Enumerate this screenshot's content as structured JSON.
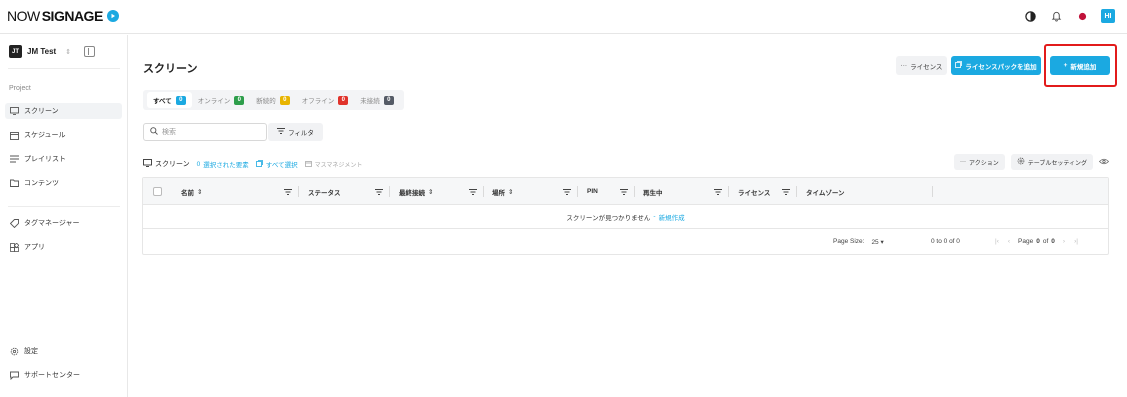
{
  "brand": {
    "logo_prefix": "NOW",
    "logo_suffix": "SIGNAGE",
    "accent": "#1ba9e1"
  },
  "topbar": {
    "avatar_initials": "HI",
    "icons": [
      "contrast-icon",
      "bell-icon",
      "record-icon",
      "avatar"
    ]
  },
  "sidebar": {
    "workspace": {
      "initials": "JT",
      "name": "JM Test"
    },
    "section_label": "Project",
    "items": [
      {
        "label": "スクリーン",
        "icon": "monitor-icon",
        "active": true
      },
      {
        "label": "スケジュール",
        "icon": "calendar-icon",
        "active": false
      },
      {
        "label": "プレイリスト",
        "icon": "playlist-icon",
        "active": false
      },
      {
        "label": "コンテンツ",
        "icon": "folder-icon",
        "active": false
      }
    ],
    "items2": [
      {
        "label": "タグマネージャー",
        "icon": "tag-icon"
      },
      {
        "label": "アプリ",
        "icon": "apps-icon"
      }
    ],
    "footer": [
      {
        "label": "設定",
        "icon": "gear-icon"
      },
      {
        "label": "サポートセンター",
        "icon": "support-icon"
      }
    ]
  },
  "page": {
    "title": "スクリーン",
    "license_button": "ライセンス",
    "add_license_pack_button": "ライセンスパックを追加",
    "add_new_button": "新規追加"
  },
  "tabs": [
    {
      "label": "すべて",
      "count": "0",
      "color": "#1ba9e1",
      "active": true
    },
    {
      "label": "オンライン",
      "count": "0",
      "color": "#2e9e4b",
      "active": false
    },
    {
      "label": "断続的",
      "count": "0",
      "color": "#e8b400",
      "active": false
    },
    {
      "label": "オフライン",
      "count": "0",
      "color": "#e0332b",
      "active": false
    },
    {
      "label": "未接続",
      "count": "0",
      "color": "#555b66",
      "active": false
    }
  ],
  "search": {
    "placeholder": "検索"
  },
  "filter_label": "フィルタ",
  "table_toolbar": {
    "screens_label": "スクリーン",
    "selected_count": "0",
    "selected_label": "選択された要素",
    "select_all_label": "すべて選択",
    "mass_management_label": "マスマネジメント",
    "action_label": "アクション",
    "table_settings_label": "テーブルセッティング"
  },
  "table": {
    "columns": [
      "名前",
      "ステータス",
      "最終接続",
      "場所",
      "PIN",
      "再生中",
      "ライセンス",
      "タイムゾーン"
    ],
    "empty_message": "スクリーンが見つかりません",
    "empty_separator": "-",
    "empty_link": "新規作成"
  },
  "pagination": {
    "page_size_label": "Page Size:",
    "page_size_value": "25",
    "range_text": "0 to 0 of 0",
    "page_word": "Page",
    "page_current": "0",
    "of_word": "of",
    "page_total": "0"
  }
}
